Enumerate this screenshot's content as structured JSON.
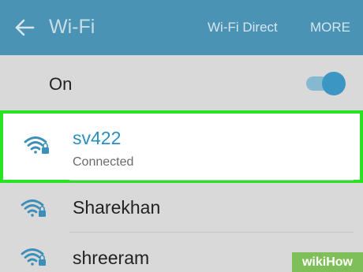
{
  "app_bar": {
    "title": "Wi-Fi",
    "wifi_direct_label": "Wi-Fi Direct",
    "more_label": "MORE",
    "accent_color": "#4a93b4"
  },
  "master_switch": {
    "label": "On",
    "state": "on"
  },
  "networks": [
    {
      "name": "sv422",
      "status": "Connected",
      "secured": true,
      "selected": true
    },
    {
      "name": "Sharekhan",
      "status": "",
      "secured": true,
      "selected": false
    },
    {
      "name": "shreeram",
      "status": "",
      "secured": true,
      "selected": false
    }
  ],
  "highlight_color": "#27e321",
  "watermark": "wikiHow"
}
